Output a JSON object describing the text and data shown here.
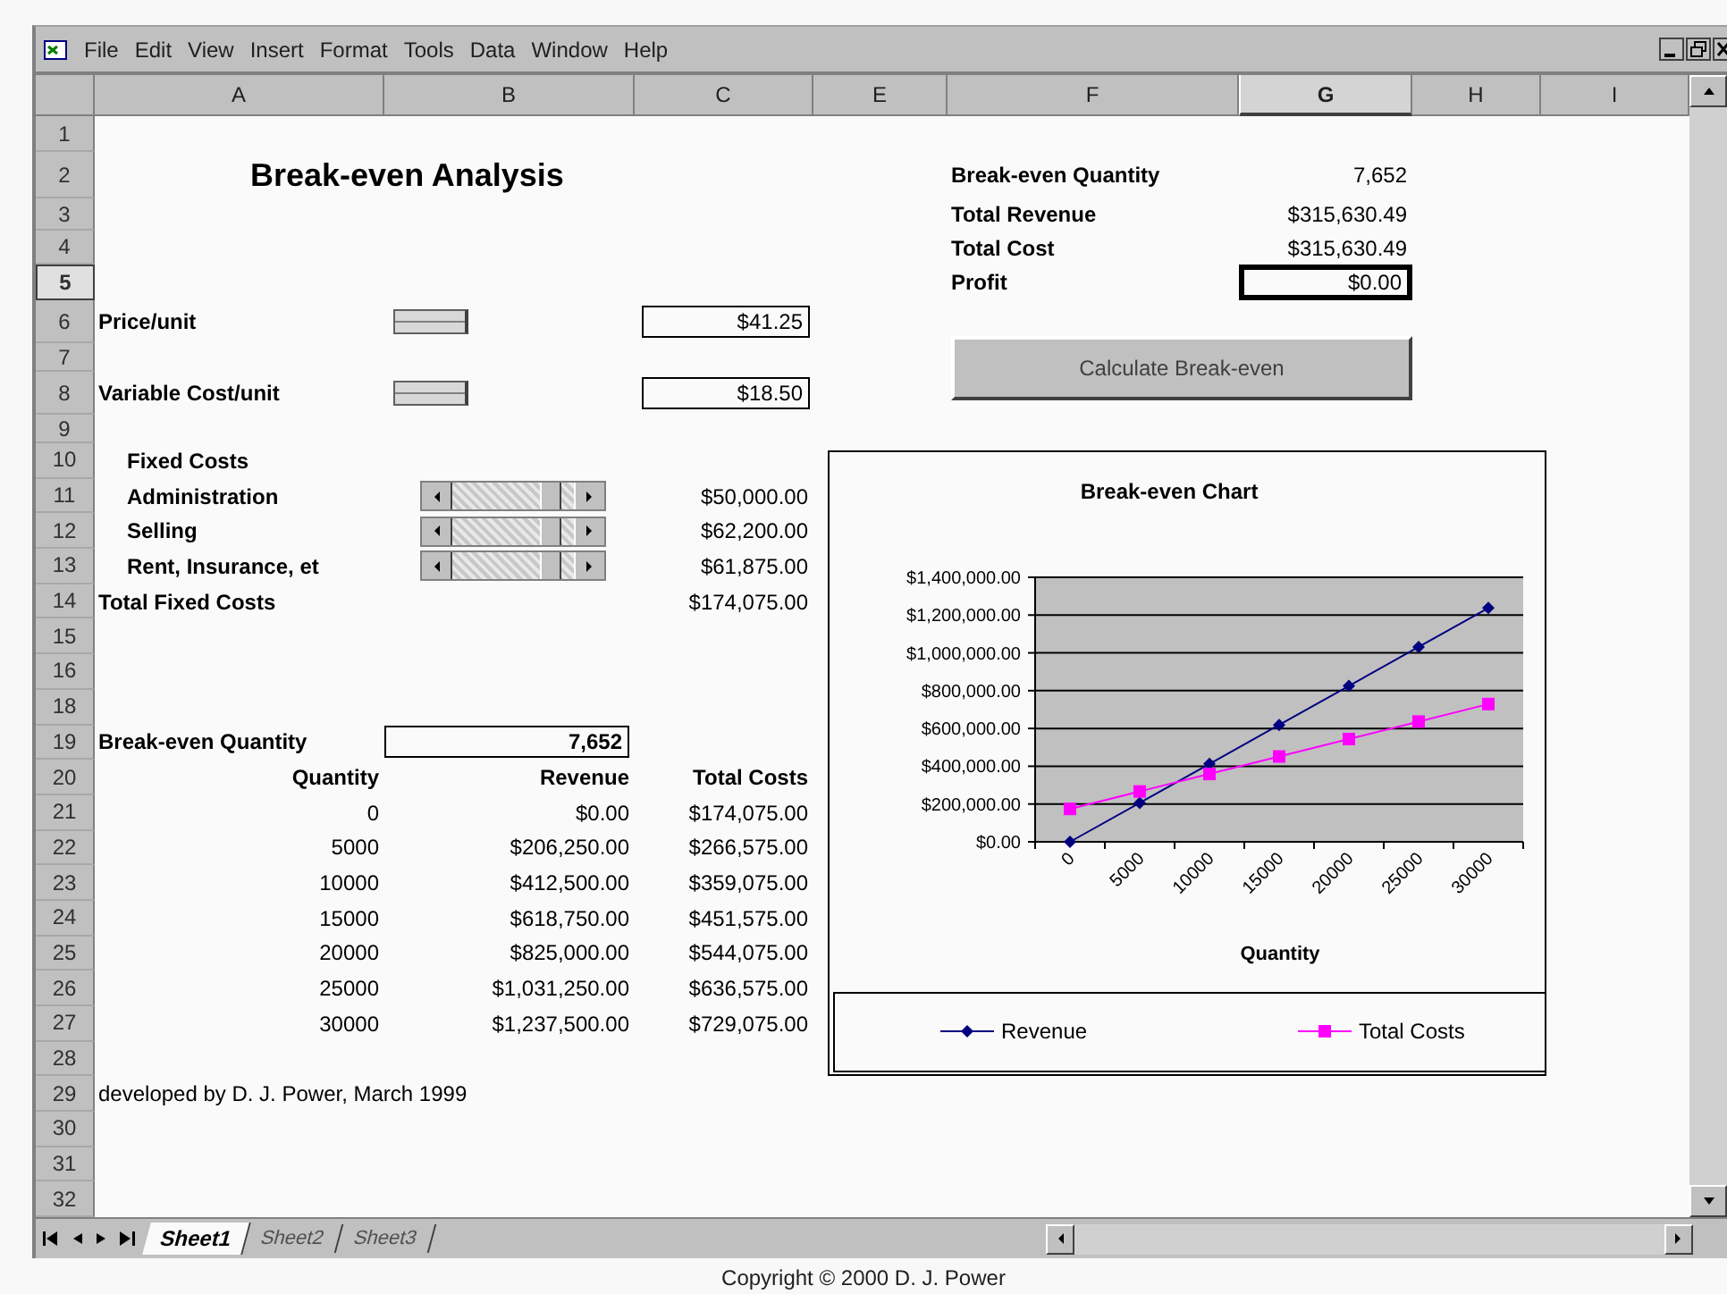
{
  "window": {
    "menu": [
      "File",
      "Edit",
      "View",
      "Insert",
      "Format",
      "Tools",
      "Data",
      "Window",
      "Help"
    ]
  },
  "sheet": {
    "columns": [
      {
        "label": "A",
        "selected": false
      },
      {
        "label": "B",
        "selected": false
      },
      {
        "label": "C",
        "selected": false
      },
      {
        "label": "E",
        "selected": false
      },
      {
        "label": "F",
        "selected": false
      },
      {
        "label": "G",
        "selected": true
      },
      {
        "label": "H",
        "selected": false
      },
      {
        "label": "I",
        "selected": false
      }
    ],
    "rows": [
      {
        "number": "1",
        "selected": false,
        "cells": {}
      },
      {
        "number": "2",
        "selected": false,
        "cells": {
          "A": {
            "kind": "title",
            "text": "Break-even Analysis"
          },
          "F": {
            "kind": "label",
            "text": "Break-even Quantity"
          },
          "G": {
            "kind": "value",
            "text": "7,652"
          }
        }
      },
      {
        "number": "3",
        "selected": false,
        "cells": {
          "F": {
            "kind": "label",
            "text": "Total Revenue"
          },
          "G": {
            "kind": "value",
            "text": "$315,630.49"
          }
        }
      },
      {
        "number": "4",
        "selected": false,
        "cells": {
          "F": {
            "kind": "label",
            "text": "Total Cost"
          },
          "G": {
            "kind": "value",
            "text": "$315,630.49"
          }
        }
      },
      {
        "number": "5",
        "selected": true,
        "cells": {
          "F": {
            "kind": "label",
            "text": "Profit"
          },
          "G": {
            "kind": "value",
            "text": "$0.00"
          }
        }
      },
      {
        "number": "6",
        "selected": false,
        "cells": {
          "A": {
            "kind": "label",
            "text": "Price/unit"
          },
          "B": {
            "kind": "spinner"
          },
          "C": {
            "kind": "input",
            "text": "$41.25"
          }
        }
      },
      {
        "number": "7",
        "selected": false,
        "cells": {}
      },
      {
        "number": "8",
        "selected": false,
        "cells": {
          "A": {
            "kind": "label",
            "text": "Variable Cost/unit"
          },
          "B": {
            "kind": "spinner"
          },
          "C": {
            "kind": "input",
            "text": "$18.50"
          }
        }
      },
      {
        "number": "9",
        "selected": false,
        "cells": {}
      },
      {
        "number": "10",
        "selected": false,
        "cells": {
          "A": {
            "kind": "sublabel",
            "text": "Fixed Costs"
          }
        }
      },
      {
        "number": "11",
        "selected": false,
        "cells": {
          "A": {
            "kind": "sublabel",
            "text": "Administration"
          },
          "B": {
            "kind": "scrollbar",
            "level": 0.85
          },
          "C": {
            "kind": "value",
            "text": "$50,000.00"
          }
        }
      },
      {
        "number": "12",
        "selected": false,
        "cells": {
          "A": {
            "kind": "sublabel",
            "text": "Selling"
          },
          "B": {
            "kind": "scrollbar",
            "level": 0.85
          },
          "C": {
            "kind": "value",
            "text": "$62,200.00"
          }
        }
      },
      {
        "number": "13",
        "selected": false,
        "cells": {
          "A": {
            "kind": "sublabel",
            "text": "Rent, Insurance, et"
          },
          "B": {
            "kind": "scrollbar",
            "level": 0.85
          },
          "C": {
            "kind": "value",
            "text": "$61,875.00"
          }
        }
      },
      {
        "number": "14",
        "selected": false,
        "cells": {
          "A": {
            "kind": "label",
            "text": "Total Fixed Costs"
          },
          "C": {
            "kind": "value",
            "text": "$174,075.00"
          }
        }
      },
      {
        "number": "15",
        "selected": false,
        "cells": {}
      },
      {
        "number": "16",
        "selected": false,
        "cells": {}
      },
      {
        "number": "18",
        "selected": false,
        "cells": {}
      },
      {
        "number": "19",
        "selected": false,
        "cells": {
          "A": {
            "kind": "label",
            "text": "Break-even Quantity"
          },
          "B": {
            "kind": "input",
            "text": "7,652"
          }
        }
      },
      {
        "number": "20",
        "selected": false,
        "cells": {
          "A": {
            "kind": "heading",
            "text": "Quantity"
          },
          "B": {
            "kind": "heading",
            "text": "Revenue"
          },
          "C": {
            "kind": "heading",
            "text": "Total Costs"
          }
        }
      },
      {
        "number": "21",
        "selected": false,
        "cells": {
          "A": {
            "kind": "value",
            "text": "0"
          },
          "B": {
            "kind": "value",
            "text": "$0.00"
          },
          "C": {
            "kind": "value",
            "text": "$174,075.00"
          }
        }
      },
      {
        "number": "22",
        "selected": false,
        "cells": {
          "A": {
            "kind": "value",
            "text": "5000"
          },
          "B": {
            "kind": "value",
            "text": "$206,250.00"
          },
          "C": {
            "kind": "value",
            "text": "$266,575.00"
          }
        }
      },
      {
        "number": "23",
        "selected": false,
        "cells": {
          "A": {
            "kind": "value",
            "text": "10000"
          },
          "B": {
            "kind": "value",
            "text": "$412,500.00"
          },
          "C": {
            "kind": "value",
            "text": "$359,075.00"
          }
        }
      },
      {
        "number": "24",
        "selected": false,
        "cells": {
          "A": {
            "kind": "value",
            "text": "15000"
          },
          "B": {
            "kind": "value",
            "text": "$618,750.00"
          },
          "C": {
            "kind": "value",
            "text": "$451,575.00"
          }
        }
      },
      {
        "number": "25",
        "selected": false,
        "cells": {
          "A": {
            "kind": "value",
            "text": "20000"
          },
          "B": {
            "kind": "value",
            "text": "$825,000.00"
          },
          "C": {
            "kind": "value",
            "text": "$544,075.00"
          }
        }
      },
      {
        "number": "26",
        "selected": false,
        "cells": {
          "A": {
            "kind": "value",
            "text": "25000"
          },
          "B": {
            "kind": "value",
            "text": "$1,031,250.00"
          },
          "C": {
            "kind": "value",
            "text": "$636,575.00"
          }
        }
      },
      {
        "number": "27",
        "selected": false,
        "cells": {
          "A": {
            "kind": "value",
            "text": "30000"
          },
          "B": {
            "kind": "value",
            "text": "$1,237,500.00"
          },
          "C": {
            "kind": "value",
            "text": "$729,075.00"
          }
        }
      },
      {
        "number": "28",
        "selected": false,
        "cells": {}
      },
      {
        "number": "29",
        "selected": false,
        "cells": {
          "A": {
            "kind": "text",
            "text": "developed by D. J. Power, March 1999"
          }
        }
      },
      {
        "number": "30",
        "selected": false,
        "cells": {}
      },
      {
        "number": "31",
        "selected": false,
        "cells": {}
      },
      {
        "number": "32",
        "selected": false,
        "cells": {}
      }
    ],
    "button": {
      "label": "Calculate Break-even"
    },
    "chart": {
      "chart_data": {
        "type": "line",
        "title": "Break-even Chart",
        "xlabel": "Quantity",
        "categories": [
          "0",
          "5000",
          "10000",
          "15000",
          "20000",
          "25000",
          "30000"
        ],
        "series": [
          {
            "name": "Revenue",
            "color": "#000080",
            "marker": "diamond",
            "values": [
              0,
              206250,
              412500,
              618750,
              825000,
              1031250,
              1237500
            ]
          },
          {
            "name": "Total Costs",
            "color": "#ff00ff",
            "marker": "square",
            "values": [
              174075,
              266575,
              359075,
              451575,
              544075,
              636575,
              729075
            ]
          }
        ],
        "ylim": [
          0,
          1400000
        ],
        "grid": true,
        "legend": true,
        "yticks": [
          {
            "value": 0,
            "label": "$0.00"
          },
          {
            "value": 200000,
            "label": "$200,000.00"
          },
          {
            "value": 400000,
            "label": "$400,000.00"
          },
          {
            "value": 600000,
            "label": "$600,000.00"
          },
          {
            "value": 800000,
            "label": "$800,000.00"
          },
          {
            "value": 1000000,
            "label": "$1,000,000.00"
          },
          {
            "value": 1200000,
            "label": "$1,200,000.00"
          },
          {
            "value": 1400000,
            "label": "$1,400,000.00"
          }
        ]
      }
    }
  },
  "sheet_tabs": [
    {
      "label": "Sheet1",
      "selected": true
    },
    {
      "label": "Sheet2",
      "selected": false
    },
    {
      "label": "Sheet3",
      "selected": false
    }
  ],
  "copyright": "Copyright © 2000 D. J. Power"
}
